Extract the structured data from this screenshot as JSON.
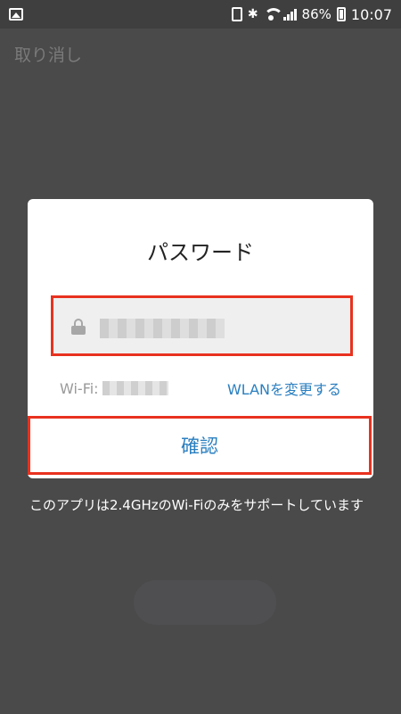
{
  "status_bar": {
    "battery": "86%",
    "time": "10:07",
    "icons": [
      "gallery-icon",
      "sim-icon",
      "bluetooth-icon",
      "wifi-icon",
      "signal-icon",
      "battery-icon"
    ]
  },
  "background": {
    "cancel_label": "取り消し",
    "note": "このアプリは2.4GHzのWi-Fiのみをサポートしています"
  },
  "dialog": {
    "title": "パスワード",
    "wifi_label": "Wi-Fi:",
    "change_wlan": "WLANを変更する",
    "confirm_label": "確認"
  },
  "colors": {
    "accent": "#2a7fc0",
    "highlight": "#e8321f",
    "overlay": "#4a4a4a"
  }
}
